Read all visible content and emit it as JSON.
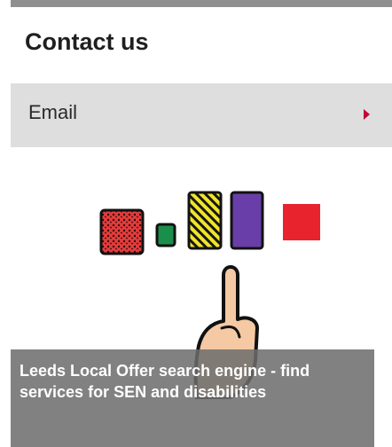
{
  "contact": {
    "heading": "Contact us",
    "items": [
      {
        "label": "Email",
        "icon": "chevron-right-icon",
        "accent": "#c4003a"
      }
    ]
  },
  "promo": {
    "caption": "Leeds Local Offer search engine - find services for SEN and disabilities",
    "icon": "pointing-hand-icon"
  }
}
